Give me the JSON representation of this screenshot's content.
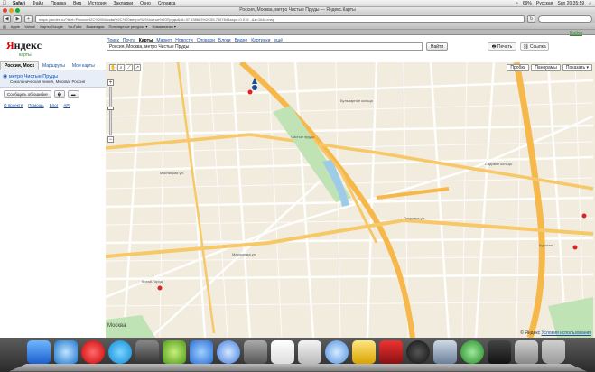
{
  "menubar": {
    "app": "Safari",
    "items": [
      "Файл",
      "Правка",
      "Вид",
      "История",
      "Закладки",
      "Окно",
      "Справка"
    ],
    "battery": "69%",
    "input_source": "Русская",
    "clock": "Sun 20:35:59"
  },
  "window": {
    "title": "Россия, Москва, метро Чистые Пруды — Яндекс.Карты"
  },
  "toolbar": {
    "url": "maps.yandex.ru/?text=Россия%2C%20Москва%2C%20метро%20Чистые%20Пруды&sll=37.638683%2C55.765784&sspn=0.019...&z=16&l=map"
  },
  "bookmarks": [
    "Apple",
    "Yahoo!",
    "Карты Google",
    "YouTube",
    "Википедия",
    "Популярные ресурсы ▾",
    "Новая папка ▾"
  ],
  "yandex": {
    "logo_red": "Я",
    "logo_rest": "ндекс",
    "logo_sub": "карты",
    "login": "Войти",
    "nav": [
      "Поиск",
      "Почта",
      "Карты",
      "Маркет",
      "Новости",
      "Словари",
      "Блоги",
      "Видео",
      "Картинки",
      "ещё"
    ],
    "nav_active": "Карты",
    "search_value": "Россия, Москва, метро Чистые Пруды",
    "find_label": "Найти",
    "print_label": "Печать",
    "link_label": "Ссылка"
  },
  "sidebar": {
    "tabs": [
      "Россия, Моск",
      "Маршруты",
      "Мои карты"
    ],
    "result_title": "метро Чистые Пруды",
    "result_addr": "Сокольническая линия, Москва, Россия",
    "report_label": "Сообщить об ошибке",
    "links": [
      "О проекте",
      "Помощь",
      "Блог",
      "API"
    ]
  },
  "map": {
    "layer_buttons": [
      "Пробки",
      "Панорамы",
      "Показать ▾"
    ],
    "zoom_level": 0.58,
    "scale_city": "Москва",
    "copyright": "© Яндекс",
    "terms": "Условия использования",
    "labels": [
      {
        "text": "Чистые пруды"
      },
      {
        "text": "Мясницкая ул."
      },
      {
        "text": "Покровка ул."
      },
      {
        "text": "Маросейка ул."
      },
      {
        "text": "Китай-Город"
      },
      {
        "text": "Курская"
      },
      {
        "text": "Бульварное кольцо"
      },
      {
        "text": "Садовое кольцо"
      }
    ]
  }
}
